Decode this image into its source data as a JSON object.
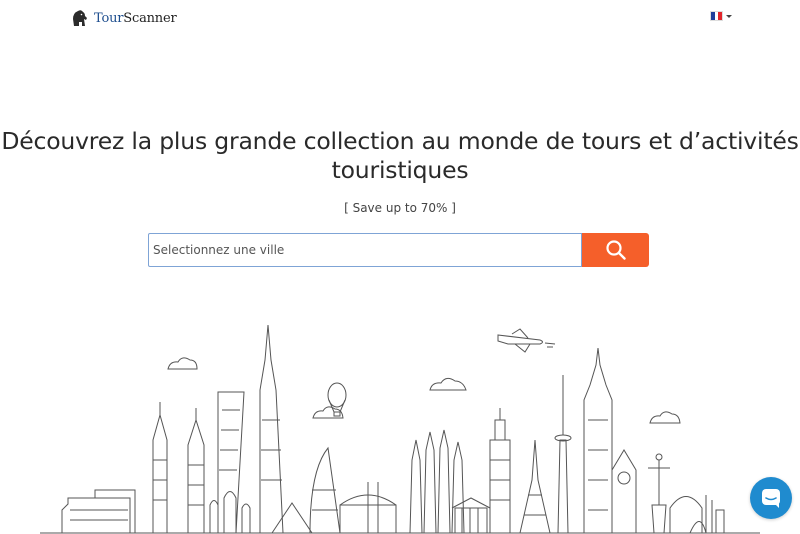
{
  "header": {
    "logo_word_1": "Tour",
    "logo_word_2": "Scanner",
    "logo_icon": "gorilla-icon",
    "language_flag": "flag-fr-icon"
  },
  "hero": {
    "headline": "Découvrez la plus grande collection au monde de tours et d’activités touristiques",
    "tagline": "[ Save up to 70% ]"
  },
  "search": {
    "placeholder": "Selectionnez une ville",
    "button_icon": "search-icon"
  },
  "colors": {
    "accent": "#f55f2a",
    "logo_blue": "#1f4f8f",
    "chat_blue": "#1f8bcf",
    "flag": [
      "#1f3f9a",
      "#ffffff",
      "#e2262b"
    ]
  },
  "illustration": {
    "icon": "world-landmarks-skyline-illustration"
  },
  "chat": {
    "icon": "chat-bubble-icon"
  }
}
